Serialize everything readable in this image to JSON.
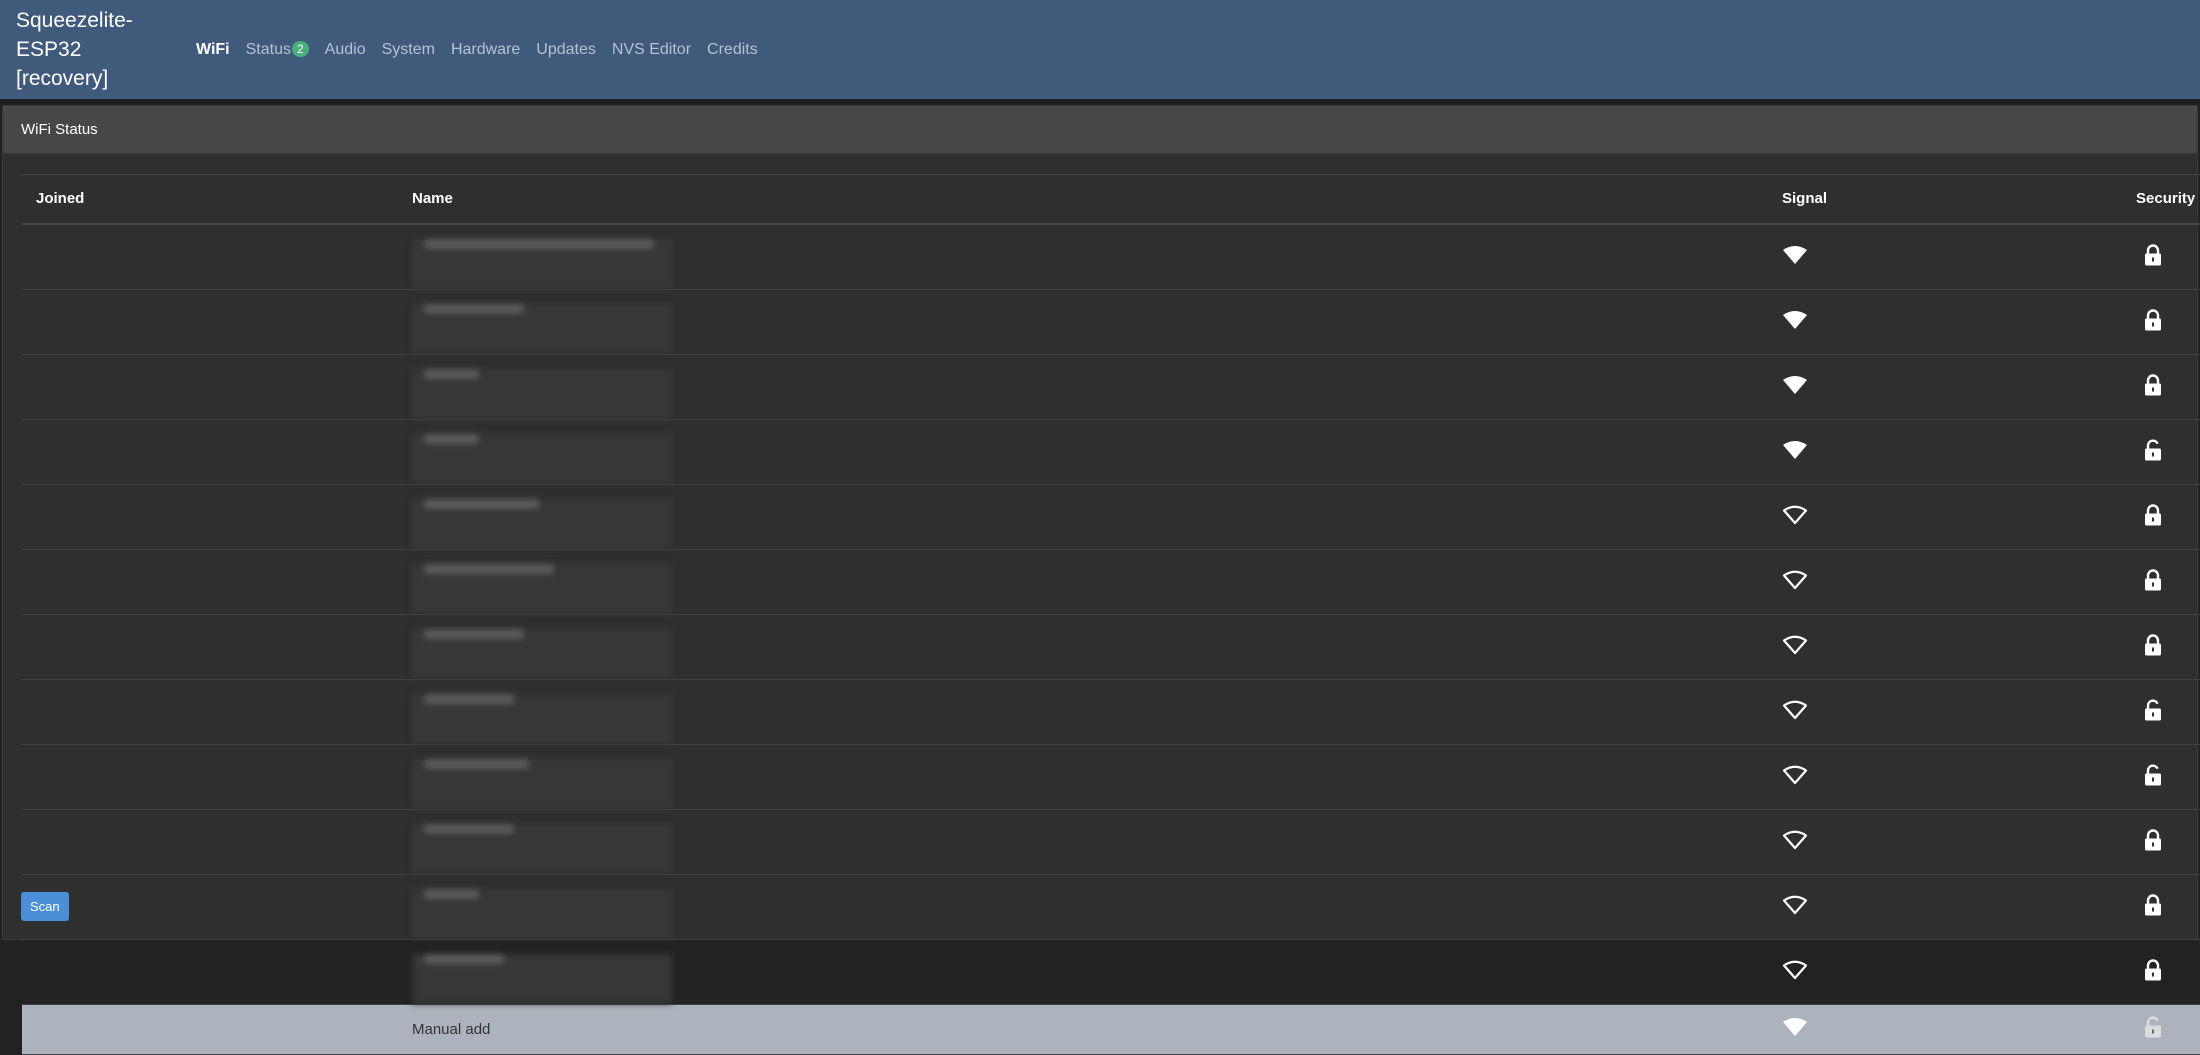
{
  "app": {
    "brand_line1": "Squeezelite-ESP32",
    "brand_line2": "[recovery]"
  },
  "nav": [
    {
      "label": "WiFi",
      "active": true
    },
    {
      "label": "Status",
      "badge": "2"
    },
    {
      "label": "Audio"
    },
    {
      "label": "System"
    },
    {
      "label": "Hardware"
    },
    {
      "label": "Updates"
    },
    {
      "label": "NVS Editor"
    },
    {
      "label": "Credits"
    }
  ],
  "wifi": {
    "title": "WiFi Status",
    "columns": {
      "joined": "Joined",
      "name": "Name",
      "signal": "Signal",
      "security": "Security"
    },
    "networks": [
      {
        "name": "",
        "signal": "wifi-strong-icon",
        "security": "lock-closed-icon"
      },
      {
        "name": "",
        "signal": "wifi-strong-icon",
        "security": "lock-closed-icon"
      },
      {
        "name": "",
        "signal": "wifi-strong-icon",
        "security": "lock-closed-icon"
      },
      {
        "name": "",
        "signal": "wifi-strong-icon",
        "security": "lock-open-icon"
      },
      {
        "name": "",
        "signal": "wifi-medium-icon",
        "security": "lock-closed-icon"
      },
      {
        "name": "",
        "signal": "wifi-medium-icon",
        "security": "lock-closed-icon"
      },
      {
        "name": "",
        "signal": "wifi-medium-icon",
        "security": "lock-closed-icon"
      },
      {
        "name": "",
        "signal": "wifi-medium-icon",
        "security": "lock-open-icon"
      },
      {
        "name": "",
        "signal": "wifi-medium-icon",
        "security": "lock-open-icon"
      },
      {
        "name": "",
        "signal": "wifi-medium-icon",
        "security": "lock-closed-icon"
      },
      {
        "name": "",
        "signal": "wifi-medium-icon",
        "security": "lock-closed-icon"
      },
      {
        "name": "",
        "signal": "wifi-medium-icon",
        "security": "lock-closed-icon"
      }
    ],
    "manual_row": {
      "name": "Manual add",
      "signal": "wifi-strong-icon",
      "security": "lock-open-icon"
    },
    "scan_label": "Scan"
  },
  "colors": {
    "navbar": "#405a7c",
    "badge": "#48b07b",
    "scan_button": "#4a8fd8",
    "manual_row": "#adb3bc"
  }
}
